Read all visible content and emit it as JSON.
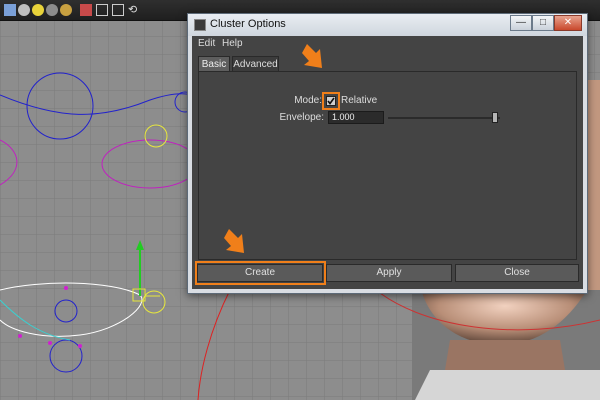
{
  "dialog": {
    "title": "Cluster Options",
    "window_buttons": {
      "minimize": "—",
      "maximize": "□",
      "close": "✕"
    }
  },
  "menubar": {
    "items": [
      "Edit",
      "Help"
    ]
  },
  "tabs": [
    {
      "label": "Basic",
      "active": true
    },
    {
      "label": "Advanced",
      "active": false
    }
  ],
  "options": {
    "mode_label": "Mode:",
    "mode_relative_label": "Relative",
    "mode_relative_checked": true,
    "envelope_label": "Envelope:",
    "envelope_value": "1.000",
    "envelope_slider_fraction": 1.0
  },
  "buttons": {
    "create": "Create",
    "apply": "Apply",
    "close": "Close"
  },
  "colors": {
    "highlight": "#f07f1a",
    "panel": "#444444",
    "titlebar": "#d9dde3"
  },
  "icons": [
    "grid-icon",
    "sphere-icon",
    "light-icon",
    "shading-icon",
    "camera-icon",
    "isolate-icon",
    "joint-icon"
  ]
}
